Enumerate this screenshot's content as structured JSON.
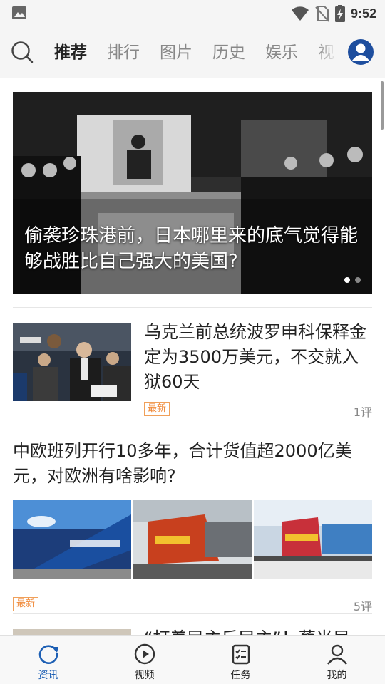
{
  "status_bar": {
    "time": "9:52",
    "icons": [
      "image-icon",
      "wifi-icon",
      "no-sim-icon",
      "battery-charging-icon"
    ]
  },
  "top_bar": {
    "icons": [
      "search-icon",
      "user-avatar-icon"
    ],
    "tabs": [
      {
        "label": "推荐",
        "active": true
      },
      {
        "label": "排行",
        "active": false
      },
      {
        "label": "图片",
        "active": false
      },
      {
        "label": "历史",
        "active": false
      },
      {
        "label": "娱乐",
        "active": false
      },
      {
        "label": "视",
        "active": false
      }
    ]
  },
  "feed": {
    "banner": {
      "caption": "偷袭珍珠港前，日本哪里来的底气觉得能够战胜比自己强大的美国?",
      "dots": 2,
      "active_dot": 0
    },
    "articles": [
      {
        "title": "乌克兰前总统波罗申科保释金定为3500万美元，不交就入狱60天",
        "tag": "最新",
        "comments": "1评"
      },
      {
        "title": "中欧班列开行10多年，合计货值超2000亿美元，对欧洲有啥影响?",
        "tag": "最新",
        "comments": "5评"
      },
      {
        "title": "“打着民主反民主”！蔡当局"
      }
    ]
  },
  "bottom_nav": {
    "items": [
      {
        "label": "资讯",
        "icon": "refresh-circle-icon",
        "active": true
      },
      {
        "label": "视频",
        "icon": "play-circle-icon",
        "active": false
      },
      {
        "label": "任务",
        "icon": "checklist-icon",
        "active": false
      },
      {
        "label": "我的",
        "icon": "person-icon",
        "active": false
      }
    ]
  },
  "colors": {
    "accent": "#1d5fb4",
    "tag_orange": "#f08a3a",
    "avatar_blue": "#1e4e9e"
  }
}
